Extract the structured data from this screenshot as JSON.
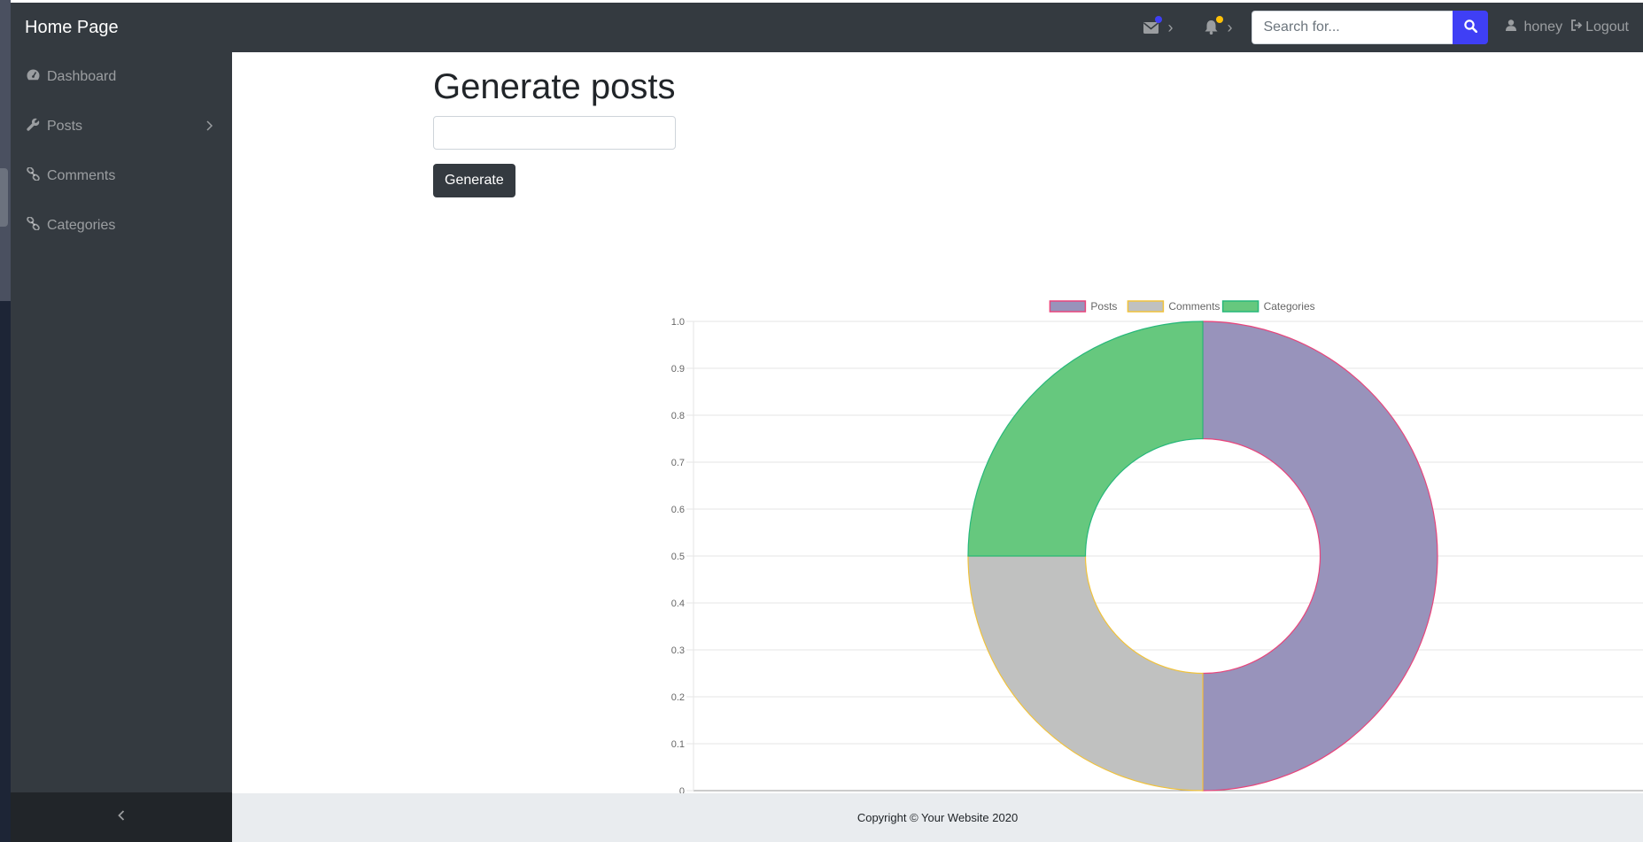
{
  "app": {
    "brand": "Home Page"
  },
  "topbar": {
    "messages_icon": "envelope-icon",
    "messages_dot_color": "#3f3ff5",
    "alerts_icon": "bell-icon",
    "alerts_dot_color": "#ffc107",
    "search": {
      "placeholder": "Search for...",
      "value": ""
    },
    "user": {
      "name": "honey",
      "logout_label": "Logout"
    }
  },
  "sidebar": {
    "items": [
      {
        "label": "Dashboard",
        "icon": "dashboard-icon"
      },
      {
        "label": "Posts",
        "icon": "wrench-icon",
        "has_submenu": true
      },
      {
        "label": "Comments",
        "icon": "link-icon"
      },
      {
        "label": "Categories",
        "icon": "link-icon"
      }
    ],
    "toggle_icon": "chevron-left-icon"
  },
  "main": {
    "title": "Generate posts",
    "input_value": "",
    "generate_label": "Generate"
  },
  "chart_data": {
    "type": "pie",
    "variant": "doughnut",
    "labels": [
      "Posts",
      "Comments",
      "Categories"
    ],
    "values": [
      2,
      1,
      1
    ],
    "colors": {
      "fill": [
        "#9893bb",
        "#c0c1c0",
        "#66c87e"
      ],
      "border": [
        "#e8457c",
        "#f0c23c",
        "#27b87a"
      ]
    },
    "legend": "top",
    "yticks": [
      "0",
      "0.1",
      "0.2",
      "0.3",
      "0.4",
      "0.5",
      "0.6",
      "0.7",
      "0.8",
      "0.9",
      "1.0"
    ],
    "ylim": [
      0,
      1
    ],
    "grid": true
  },
  "footer": {
    "text": "Copyright © Your Website 2020"
  }
}
